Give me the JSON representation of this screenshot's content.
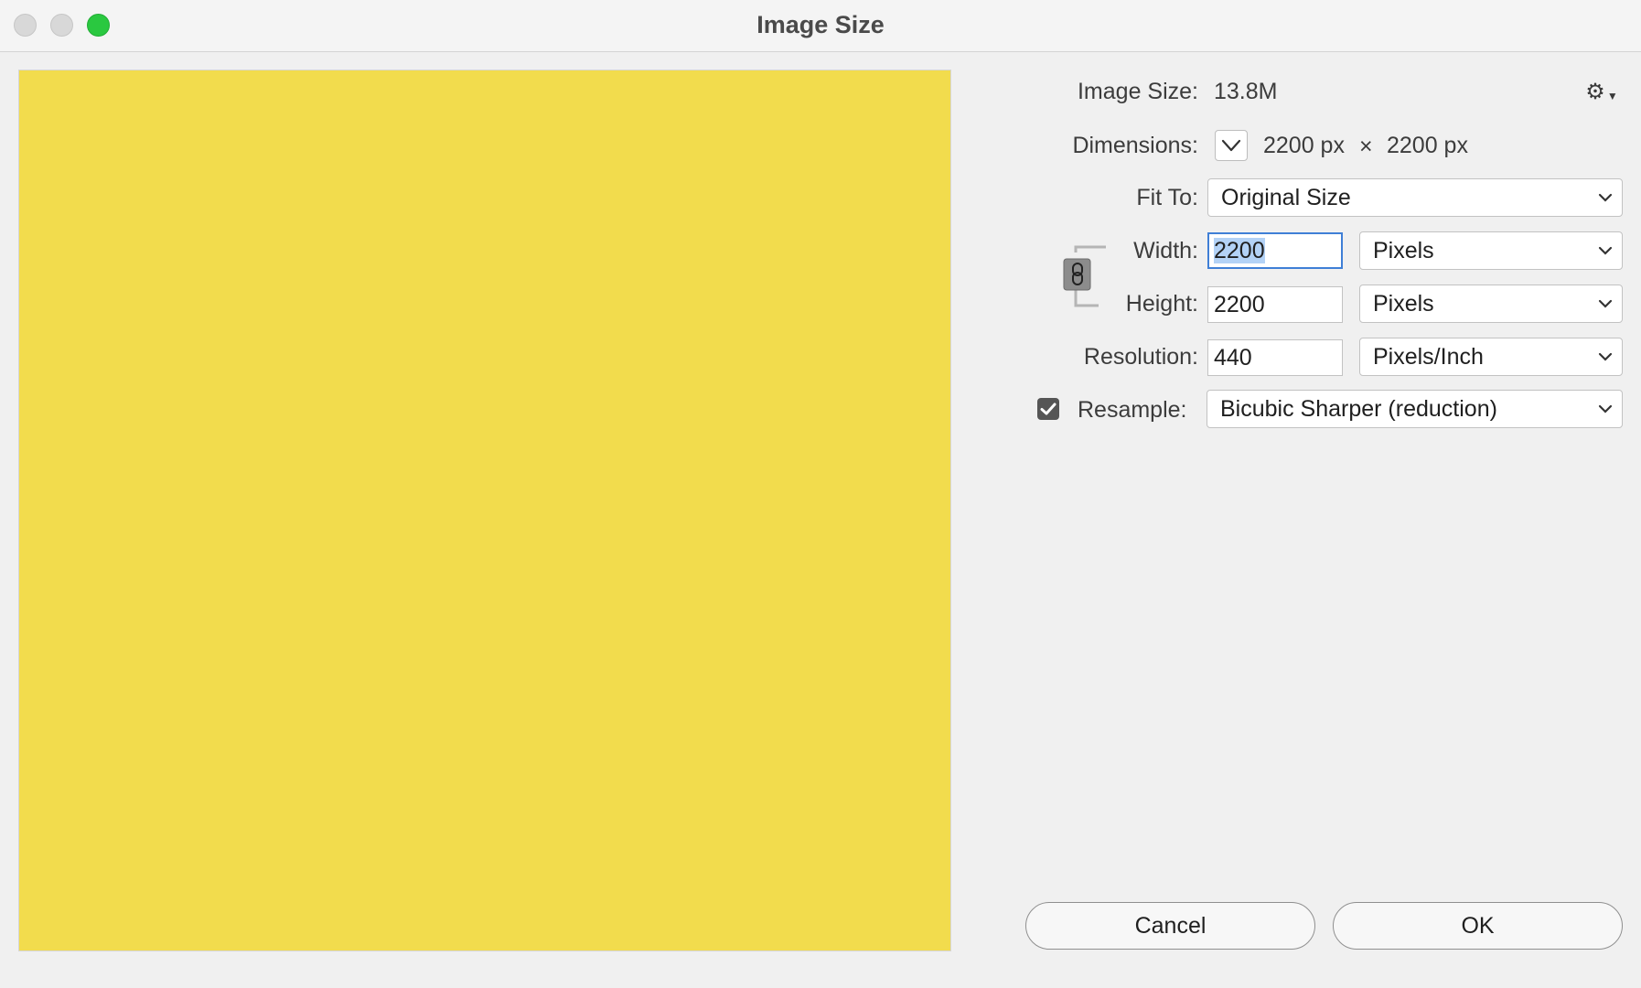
{
  "window": {
    "title": "Image Size"
  },
  "preview": {
    "fill_color": "#f2dc4d"
  },
  "info": {
    "image_size_label": "Image Size:",
    "image_size_value": "13.8M",
    "dimensions_label": "Dimensions:",
    "dim_width": "2200 px",
    "dim_sep": "×",
    "dim_height": "2200 px"
  },
  "form": {
    "fit_to_label": "Fit To:",
    "fit_to_value": "Original Size",
    "width_label": "Width:",
    "width_value": "2200",
    "width_unit": "Pixels",
    "height_label": "Height:",
    "height_value": "2200",
    "height_unit": "Pixels",
    "resolution_label": "Resolution:",
    "resolution_value": "440",
    "resolution_unit": "Pixels/Inch",
    "resample_label": "Resample:",
    "resample_checked": true,
    "resample_value": "Bicubic Sharper (reduction)"
  },
  "buttons": {
    "cancel_label": "Cancel",
    "ok_label": "OK"
  },
  "colors": {
    "accent": "#3f7fd6",
    "selection": "#b3d2f6",
    "zoom_button": "#2ac840"
  }
}
